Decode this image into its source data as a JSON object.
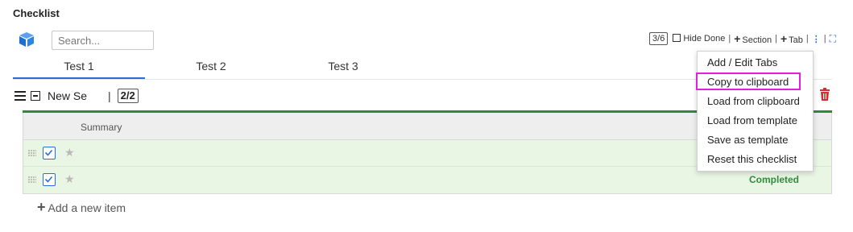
{
  "header": {
    "title": "Checklist",
    "search_placeholder": "Search..."
  },
  "toolbar": {
    "progress": "3/6",
    "hide_done_label": "Hide Done",
    "add_section_label": "Section",
    "add_tab_label": "Tab",
    "separator": "|",
    "plus_glyph": "+",
    "kebab_glyph": "⋮",
    "expand_glyph": "⛶"
  },
  "tabs": [
    {
      "label": "Test 1",
      "active": true
    },
    {
      "label": "Test 2",
      "active": false
    },
    {
      "label": "Test 3",
      "active": false
    }
  ],
  "section": {
    "name": "New Se",
    "separator": "|",
    "count": "2/2"
  },
  "table": {
    "header": "Summary",
    "rows": [
      {
        "checked": true,
        "status": ""
      },
      {
        "checked": true,
        "status": "Completed"
      }
    ]
  },
  "add_item": {
    "plus": "+",
    "label": "Add a new item"
  },
  "menu": {
    "items": [
      "Add / Edit Tabs",
      "Copy to clipboard",
      "Load from clipboard",
      "Load from template",
      "Save as template",
      "Reset this checklist"
    ],
    "highlighted": "Copy to clipboard"
  },
  "colors": {
    "accent": "#2a6fd6",
    "success": "#2e8b3d",
    "danger": "#d32f2f",
    "highlight": "#e020e0"
  },
  "icons": {
    "app": "cube-icon",
    "row_handle": "grip-icon",
    "row_check": "checkbox-icon",
    "row_fav": "star-icon",
    "delete": "trash-icon"
  }
}
